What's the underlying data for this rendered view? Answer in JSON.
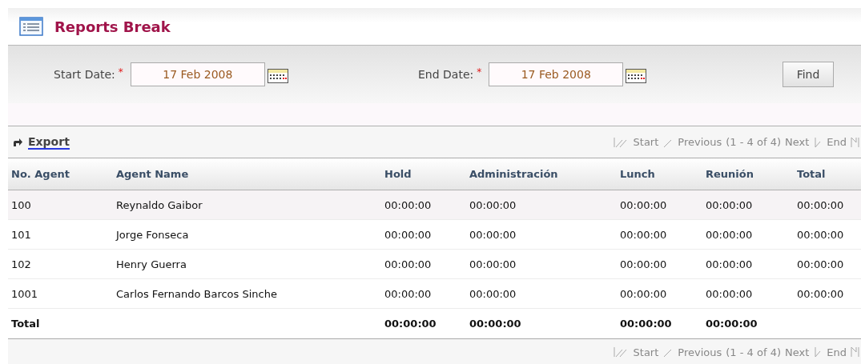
{
  "title": "Reports Break",
  "filters": [
    {
      "label": "Start Date:",
      "required_mark": "*",
      "value": "17 Feb 2008"
    },
    {
      "label": "End Date:",
      "required_mark": "*",
      "value": "17 Feb 2008"
    }
  ],
  "find_button": "Find",
  "export_link": "Export",
  "pagination_top": {
    "start": "Start",
    "previous": "Previous",
    "range": "(1 - 4 of 4)",
    "next": "Next",
    "end": "End"
  },
  "table": {
    "columns": [
      "No. Agent",
      "Agent Name",
      "Hold",
      "Administración",
      "Lunch",
      "Reunión",
      "Total"
    ],
    "rows": [
      [
        "100",
        "Reynaldo Gaibor",
        "00:00:00",
        "00:00:00",
        "00:00:00",
        "00:00:00",
        "00:00:00"
      ],
      [
        "101",
        "Jorge Fonseca",
        "00:00:00",
        "00:00:00",
        "00:00:00",
        "00:00:00",
        "00:00:00"
      ],
      [
        "102",
        "Henry Guerra",
        "00:00:00",
        "00:00:00",
        "00:00:00",
        "00:00:00",
        "00:00:00"
      ],
      [
        "1001",
        "Carlos Fernando Barcos Sinche",
        "00:00:00",
        "00:00:00",
        "00:00:00",
        "00:00:00",
        "00:00:00"
      ]
    ],
    "total_row": {
      "label": "Total",
      "values": [
        "00:00:00",
        "00:00:00",
        "00:00:00",
        "00:00:00"
      ]
    }
  },
  "pagination_bottom": {
    "start": "Start",
    "previous": "Previous",
    "range": "(1 - 4 of 4)",
    "next": "Next",
    "end": "End"
  }
}
